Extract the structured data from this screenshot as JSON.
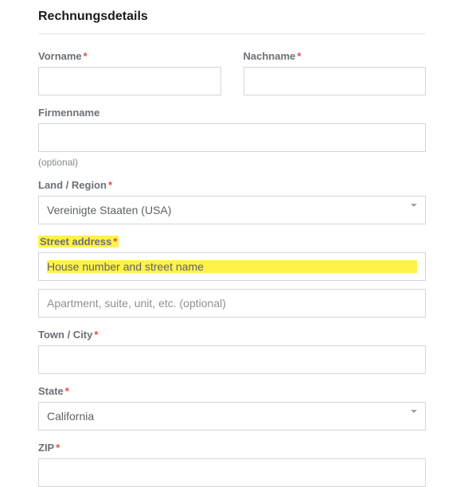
{
  "heading": "Rechnungsdetails",
  "fields": {
    "firstName": {
      "label": "Vorname",
      "required": true,
      "value": ""
    },
    "lastName": {
      "label": "Nachname",
      "required": true,
      "value": ""
    },
    "company": {
      "label": "Firmenname",
      "value": "",
      "helper": "(optional)"
    },
    "country": {
      "label": "Land / Region",
      "required": true,
      "selected": "Vereinigte Staaten (USA)"
    },
    "street": {
      "label": "Street address",
      "required": true,
      "line1_placeholder": "House number and street name",
      "line1_value": "",
      "line2_placeholder": "Apartment, suite, unit, etc. (optional)",
      "line2_value": ""
    },
    "city": {
      "label": "Town / City",
      "required": true,
      "value": ""
    },
    "state": {
      "label": "State",
      "required": true,
      "selected": "California"
    },
    "zip": {
      "label": "ZIP",
      "required": true,
      "value": ""
    }
  },
  "asterisk": "*"
}
